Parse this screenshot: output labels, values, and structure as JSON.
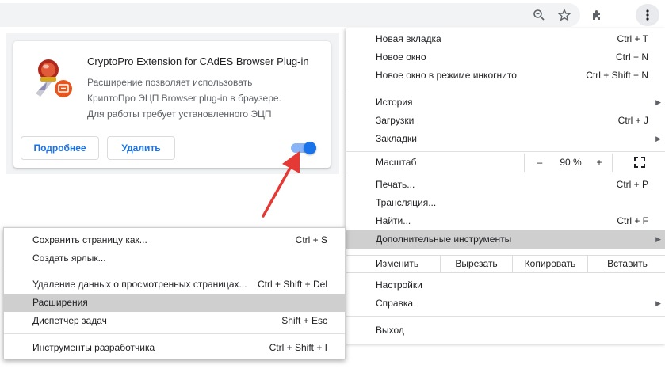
{
  "toolbar": {
    "zoom_icon": "magnifier-icon",
    "bookmark_icon": "star-icon",
    "extensions_icon": "puzzle-icon",
    "menu_icon": "kebab-menu-icon"
  },
  "extension_card": {
    "title": "CryptoPro Extension for CAdES Browser Plug-in",
    "description_lines": [
      "Расширение позволяет использовать",
      "КриптоПро ЭЦП Browser plug-in в браузере.",
      "Для работы требует установленного ЭЦП"
    ],
    "details_label": "Подробнее",
    "remove_label": "Удалить",
    "enabled": true
  },
  "main_menu": {
    "new_tab": {
      "label": "Новая вкладка",
      "shortcut": "Ctrl + T"
    },
    "new_window": {
      "label": "Новое окно",
      "shortcut": "Ctrl + N"
    },
    "incognito": {
      "label": "Новое окно в режиме инкогнито",
      "shortcut": "Ctrl + Shift + N"
    },
    "history": {
      "label": "История"
    },
    "downloads": {
      "label": "Загрузки",
      "shortcut": "Ctrl + J"
    },
    "bookmarks": {
      "label": "Закладки"
    },
    "zoom": {
      "label": "Масштаб",
      "minus": "–",
      "value": "90 %",
      "plus": "+"
    },
    "print": {
      "label": "Печать...",
      "shortcut": "Ctrl + P"
    },
    "cast": {
      "label": "Трансляция..."
    },
    "find": {
      "label": "Найти...",
      "shortcut": "Ctrl + F"
    },
    "more_tools": {
      "label": "Дополнительные инструменты"
    },
    "edit": {
      "label": "Изменить",
      "cut": "Вырезать",
      "copy": "Копировать",
      "paste": "Вставить"
    },
    "settings": {
      "label": "Настройки"
    },
    "help": {
      "label": "Справка"
    },
    "exit": {
      "label": "Выход"
    }
  },
  "sub_menu": {
    "save_page": {
      "label": "Сохранить страницу как...",
      "shortcut": "Ctrl + S"
    },
    "create_shortcut": {
      "label": "Создать ярлык..."
    },
    "clear_data": {
      "label": "Удаление данных о просмотренных страницах...",
      "shortcut": "Ctrl + Shift + Del"
    },
    "extensions": {
      "label": "Расширения"
    },
    "task_manager": {
      "label": "Диспетчер задач",
      "shortcut": "Shift + Esc"
    },
    "dev_tools": {
      "label": "Инструменты разработчика",
      "shortcut": "Ctrl + Shift + I"
    }
  },
  "colors": {
    "accent": "#1a73e8",
    "highlight": "#cfcfcf",
    "annotation_arrow": "#e53935"
  }
}
